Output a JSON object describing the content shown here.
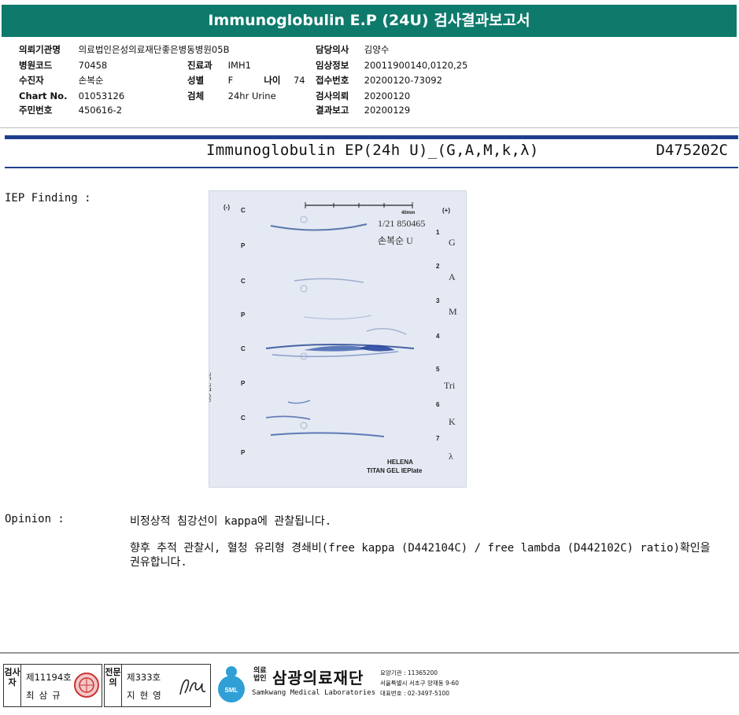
{
  "header": {
    "title": "Immunoglobulin E.P (24U) 검사결과보고서"
  },
  "patient_info": {
    "institution_label": "의뢰기관명",
    "institution": "의료법인은성의료재단좋은병동병원05B",
    "hospital_code_label": "병원코드",
    "hospital_code": "70458",
    "collector_label": "수진자",
    "collector": "손복순",
    "chart_label": "Chart No.",
    "chart": "01053126",
    "resident_label": "주민번호",
    "resident": "450616-2",
    "dept_label": "진료과",
    "dept": "IMH1",
    "sex_label": "성별",
    "sex": "F",
    "age_label": "나이",
    "age": "74",
    "specimen_label": "검체",
    "specimen": "24hr Urine",
    "doctor_label": "담당의사",
    "doctor": "김양수",
    "clinical_label": "임상정보",
    "clinical": "20011900140,0120,25",
    "receipt_label": "접수번호",
    "receipt": "20200120-73092",
    "request_label": "검사의뢰",
    "request": "20200120",
    "report_label": "결과보고",
    "report": "20200129"
  },
  "test": {
    "name": "Immunoglobulin EP(24h U)_(G,A,M,k,λ)",
    "code": "D475202C"
  },
  "iep": {
    "label": "IEP Finding :",
    "gel": {
      "neg": "(-)",
      "pos": "(+)",
      "scale": "40mm",
      "handwrite1": "1/21 850465",
      "handwrite2": "손복순 U",
      "side_id": "35 37 09",
      "left_letters": [
        "C",
        "P",
        "C",
        "P",
        "C",
        "P",
        "C",
        "P"
      ],
      "right_labels": [
        "G",
        "A",
        "M",
        "Tri",
        "K",
        "λ"
      ],
      "right_numbers": [
        "1",
        "2",
        "3",
        "4",
        "5",
        "6",
        "7"
      ],
      "brand1": "HELENA",
      "brand2": "TITAN GEL IEPlate"
    }
  },
  "opinion": {
    "label": "Opinion :",
    "line1": "비정상적 침강선이 kappa에 관찰됩니다.",
    "line2": "향후 추적 관찰시, 혈청 유리형 경쇄비(free kappa (D442104C) / free lambda (D442102C) ratio)확인을 권유합니다."
  },
  "footer": {
    "examiner_label": "검사자",
    "examiner_no": "제11194호",
    "examiner_name": "최삼규",
    "specialist_label": "전문의",
    "specialist_no": "제333호",
    "specialist_name": "지현영",
    "org_prefix": "의료법인",
    "org_name": "삼광의료재단",
    "org_logo": "SML",
    "org_english": "Samkwang Medical Laboratories",
    "org_code": "요양기관 : 11365200",
    "org_address": "서울특별시 서초구 양재동 9-60",
    "org_phone": "대표번호 : 02-3497-5100"
  },
  "colors": {
    "title_bg": "#0e7a6c",
    "rule_blue": "#1f3f8c"
  }
}
